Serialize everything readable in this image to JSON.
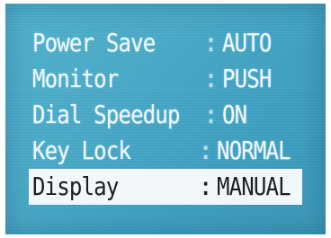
{
  "menu": {
    "items": [
      {
        "label": "Power Save",
        "value": "AUTO"
      },
      {
        "label": "Monitor",
        "value": "PUSH"
      },
      {
        "label": "Dial Speedup",
        "value": "ON"
      },
      {
        "label": "Key Lock",
        "value": "NORMAL"
      },
      {
        "label": "Display",
        "value": "MANUAL"
      }
    ],
    "separator": ":",
    "selected_index": 4
  },
  "colors": {
    "screen_background": "#49aac9",
    "text": "#f4fbff",
    "highlight_background": "#f7fbfd",
    "highlight_text": "#1a1a1a"
  }
}
